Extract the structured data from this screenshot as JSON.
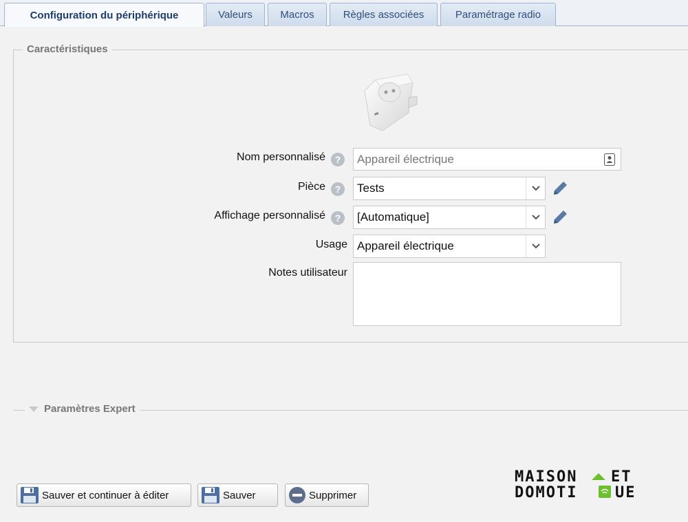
{
  "tabs": [
    {
      "label": "Configuration du périphérique",
      "active": true
    },
    {
      "label": "Valeurs",
      "active": false
    },
    {
      "label": "Macros",
      "active": false
    },
    {
      "label": "Règles associées",
      "active": false
    },
    {
      "label": "Paramétrage radio",
      "active": false
    }
  ],
  "characteristics": {
    "legend": "Caractéristiques",
    "device_icon": "power-plug-image",
    "name": {
      "label": "Nom personnalisé",
      "placeholder": "Appareil électrique",
      "value": ""
    },
    "room": {
      "label": "Pièce",
      "value": "Tests"
    },
    "display": {
      "label": "Affichage personnalisé",
      "value": "[Automatique]"
    },
    "usage": {
      "label": "Usage",
      "value": "Appareil électrique"
    },
    "notes": {
      "label": "Notes utilisateur",
      "value": ""
    }
  },
  "expert": {
    "title": "Paramètres Expert"
  },
  "buttons": {
    "save_continue": "Sauver et continuer à éditer",
    "save": "Sauver",
    "delete": "Supprimer"
  },
  "logo": {
    "line1": "MAISON",
    "line1b": "ET",
    "line2": "DOMOTI",
    "line2b": "UE"
  },
  "colors": {
    "accent": "#2f4f7a",
    "logo_green": "#6cbf2f",
    "icon_blue": "#5b7aa6"
  }
}
